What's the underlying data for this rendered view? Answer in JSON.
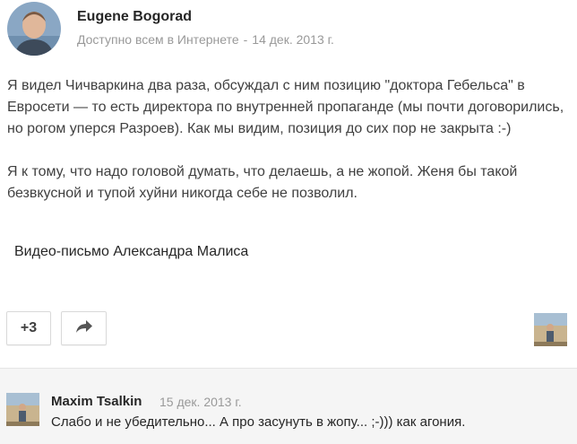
{
  "post": {
    "author": "Eugene Bogorad",
    "visibility": "Доступно всем в Интернете",
    "separator": "-",
    "date": "14 дек. 2013 г.",
    "paragraphs": [
      "Я видел Чичваркина два раза, обсуждал с ним позицию \"доктора Гебельса\" в Евросети — то есть директора по внутренней пропаганде (мы почти договорились, но рогом уперся Разроев). Как мы видим, позиция до сих пор не закрыта :-)",
      "Я к тому, что надо головой думать, что делаешь, а не жопой. Женя бы такой безвкусной и тупой хуйни никогда себе не позволил."
    ],
    "link_title": "Видео-письмо Александра Малиса",
    "plus_label": "+3",
    "share_icon": "share-arrow-icon"
  },
  "comment": {
    "author": "Maxim Tsalkin",
    "date": "15 дек. 2013 г.",
    "text": "Слабо и не убедительно... А про засунуть в жопу... ;-))) как агония."
  }
}
